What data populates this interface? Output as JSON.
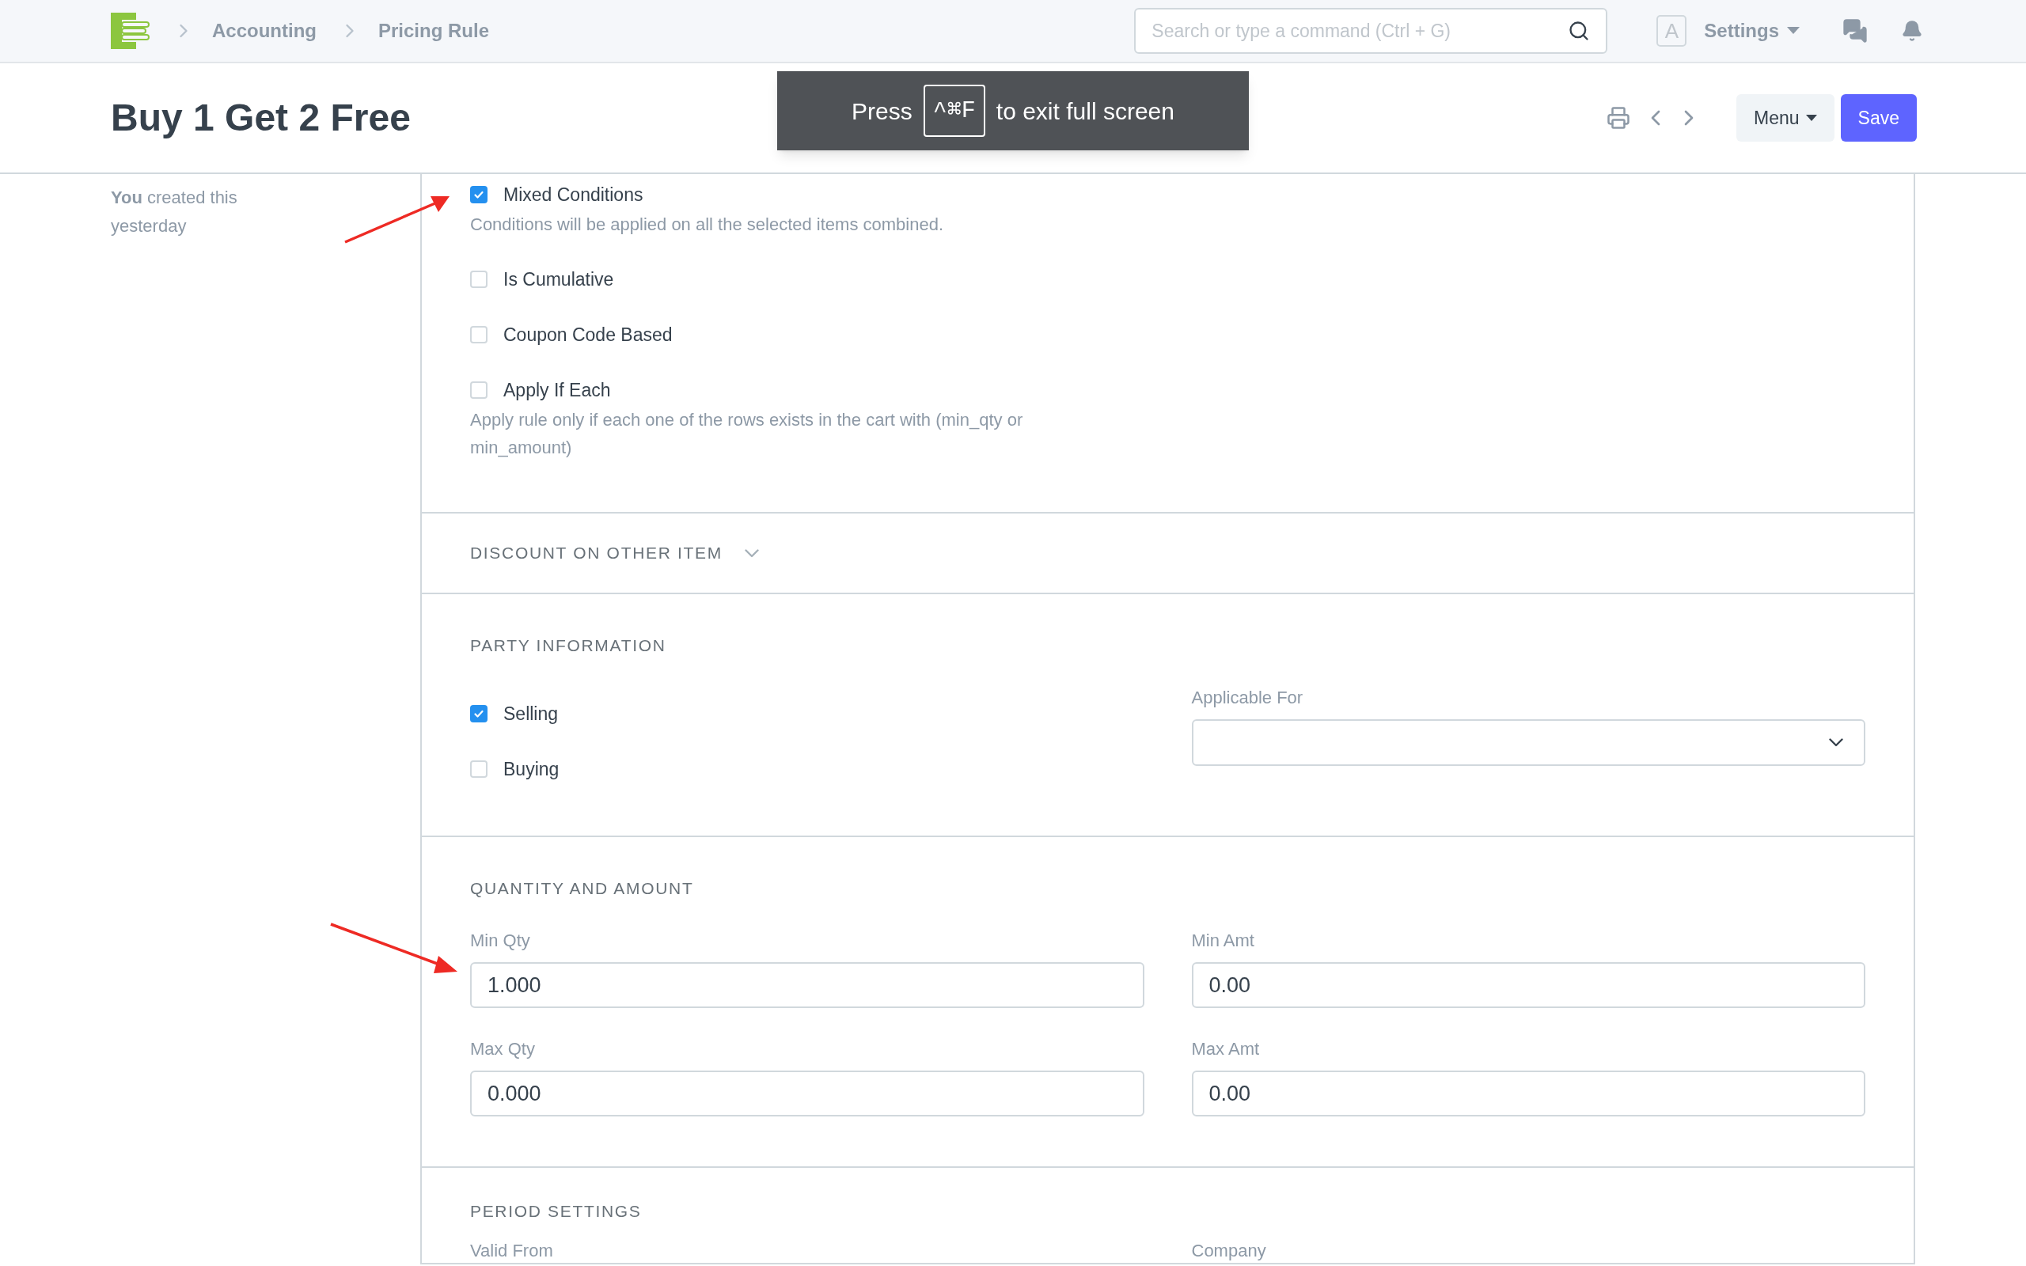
{
  "topbar": {
    "breadcrumbs": [
      "Accounting",
      "Pricing Rule"
    ],
    "search": {
      "placeholder": "Search or type a command (Ctrl + G)"
    },
    "avatar": "A",
    "settings": "Settings"
  },
  "page": {
    "title": "Buy 1 Get 2 Free",
    "menu": "Menu",
    "save": "Save"
  },
  "fullscreen_hint": {
    "before": "Press",
    "key": "^⌘F",
    "after": "to exit full screen"
  },
  "sidebar": {
    "created": "**You** created this yesterday"
  },
  "sections": [
    {
      "columns": [
        [
          {
            "kind": "checkbox",
            "label": "Mixed Conditions",
            "checked": true,
            "description": "Conditions will be applied on all the selected items combined."
          },
          {
            "kind": "checkbox",
            "label": "Is Cumulative",
            "checked": false
          },
          {
            "kind": "checkbox",
            "label": "Coupon Code Based",
            "checked": false
          },
          {
            "kind": "checkbox",
            "label": "Apply If Each",
            "checked": false,
            "description": "Apply rule only if each one of the rows exists in the cart with (min_qty or min_amount)"
          }
        ]
      ]
    },
    {
      "heading": "DISCOUNT ON OTHER ITEM",
      "collapsed": true
    },
    {
      "heading": "PARTY INFORMATION",
      "columns": [
        [
          {
            "kind": "checkbox",
            "label": "Selling",
            "checked": true
          },
          {
            "kind": "checkbox",
            "label": "Buying",
            "checked": false
          }
        ],
        [
          {
            "kind": "select",
            "label": "Applicable For"
          }
        ]
      ]
    },
    {
      "heading": "QUANTITY AND AMOUNT",
      "columns": [
        [
          {
            "kind": "input",
            "label": "Min Qty",
            "value": "1.000"
          },
          {
            "kind": "input",
            "label": "Max Qty",
            "value": "0.000"
          }
        ],
        [
          {
            "kind": "input",
            "label": "Min Amt",
            "value": "0.00"
          },
          {
            "kind": "input",
            "label": "Max Amt",
            "value": "0.00"
          }
        ]
      ]
    },
    {
      "heading": "PERIOD SETTINGS",
      "columns": [
        [
          {
            "kind": "label",
            "label": "Valid From"
          }
        ],
        [
          {
            "kind": "label",
            "label": "Company"
          }
        ]
      ]
    }
  ]
}
